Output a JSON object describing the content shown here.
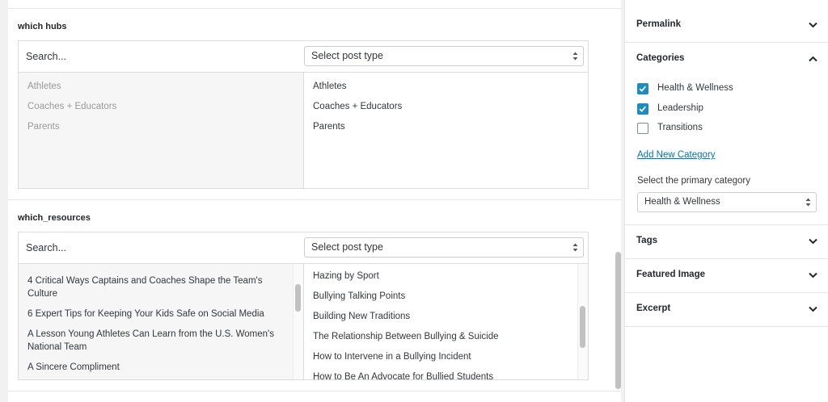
{
  "hubs": {
    "label": "which hubs",
    "search_placeholder": "Search...",
    "post_type_select": "Select post type",
    "available": [
      "Athletes",
      "Coaches + Educators",
      "Parents"
    ],
    "selected": [
      "Athletes",
      "Coaches + Educators",
      "Parents"
    ]
  },
  "resources": {
    "label": "which_resources",
    "search_placeholder": "Search...",
    "post_type_select": "Select post type",
    "available": [
      "4 Critical Ways Captains and Coaches Shape the Team's Culture",
      "6 Expert Tips for Keeping Your Kids Safe on Social Media",
      "A Lesson Young Athletes Can Learn from the U.S. Women's National Team",
      "A Sincere Compliment"
    ],
    "selected": [
      "Hazing by Sport",
      "Bullying Talking Points",
      "Building New Traditions",
      "The Relationship Between Bullying & Suicide",
      "How to Intervene in a Bullying Incident",
      "How to Be An Advocate for Bullied Students"
    ]
  },
  "sidebar": {
    "permalink": "Permalink",
    "categories": {
      "title": "Categories",
      "items": [
        {
          "label": "Health & Wellness",
          "checked": true
        },
        {
          "label": "Leadership",
          "checked": true
        },
        {
          "label": "Transitions",
          "checked": false
        }
      ],
      "add_new": "Add New Category",
      "primary_label": "Select the primary category",
      "primary_value": "Health & Wellness"
    },
    "tags": "Tags",
    "featured_image": "Featured Image",
    "excerpt": "Excerpt"
  },
  "colors": {
    "accent": "#1e8cbe",
    "link": "#0073aa"
  }
}
